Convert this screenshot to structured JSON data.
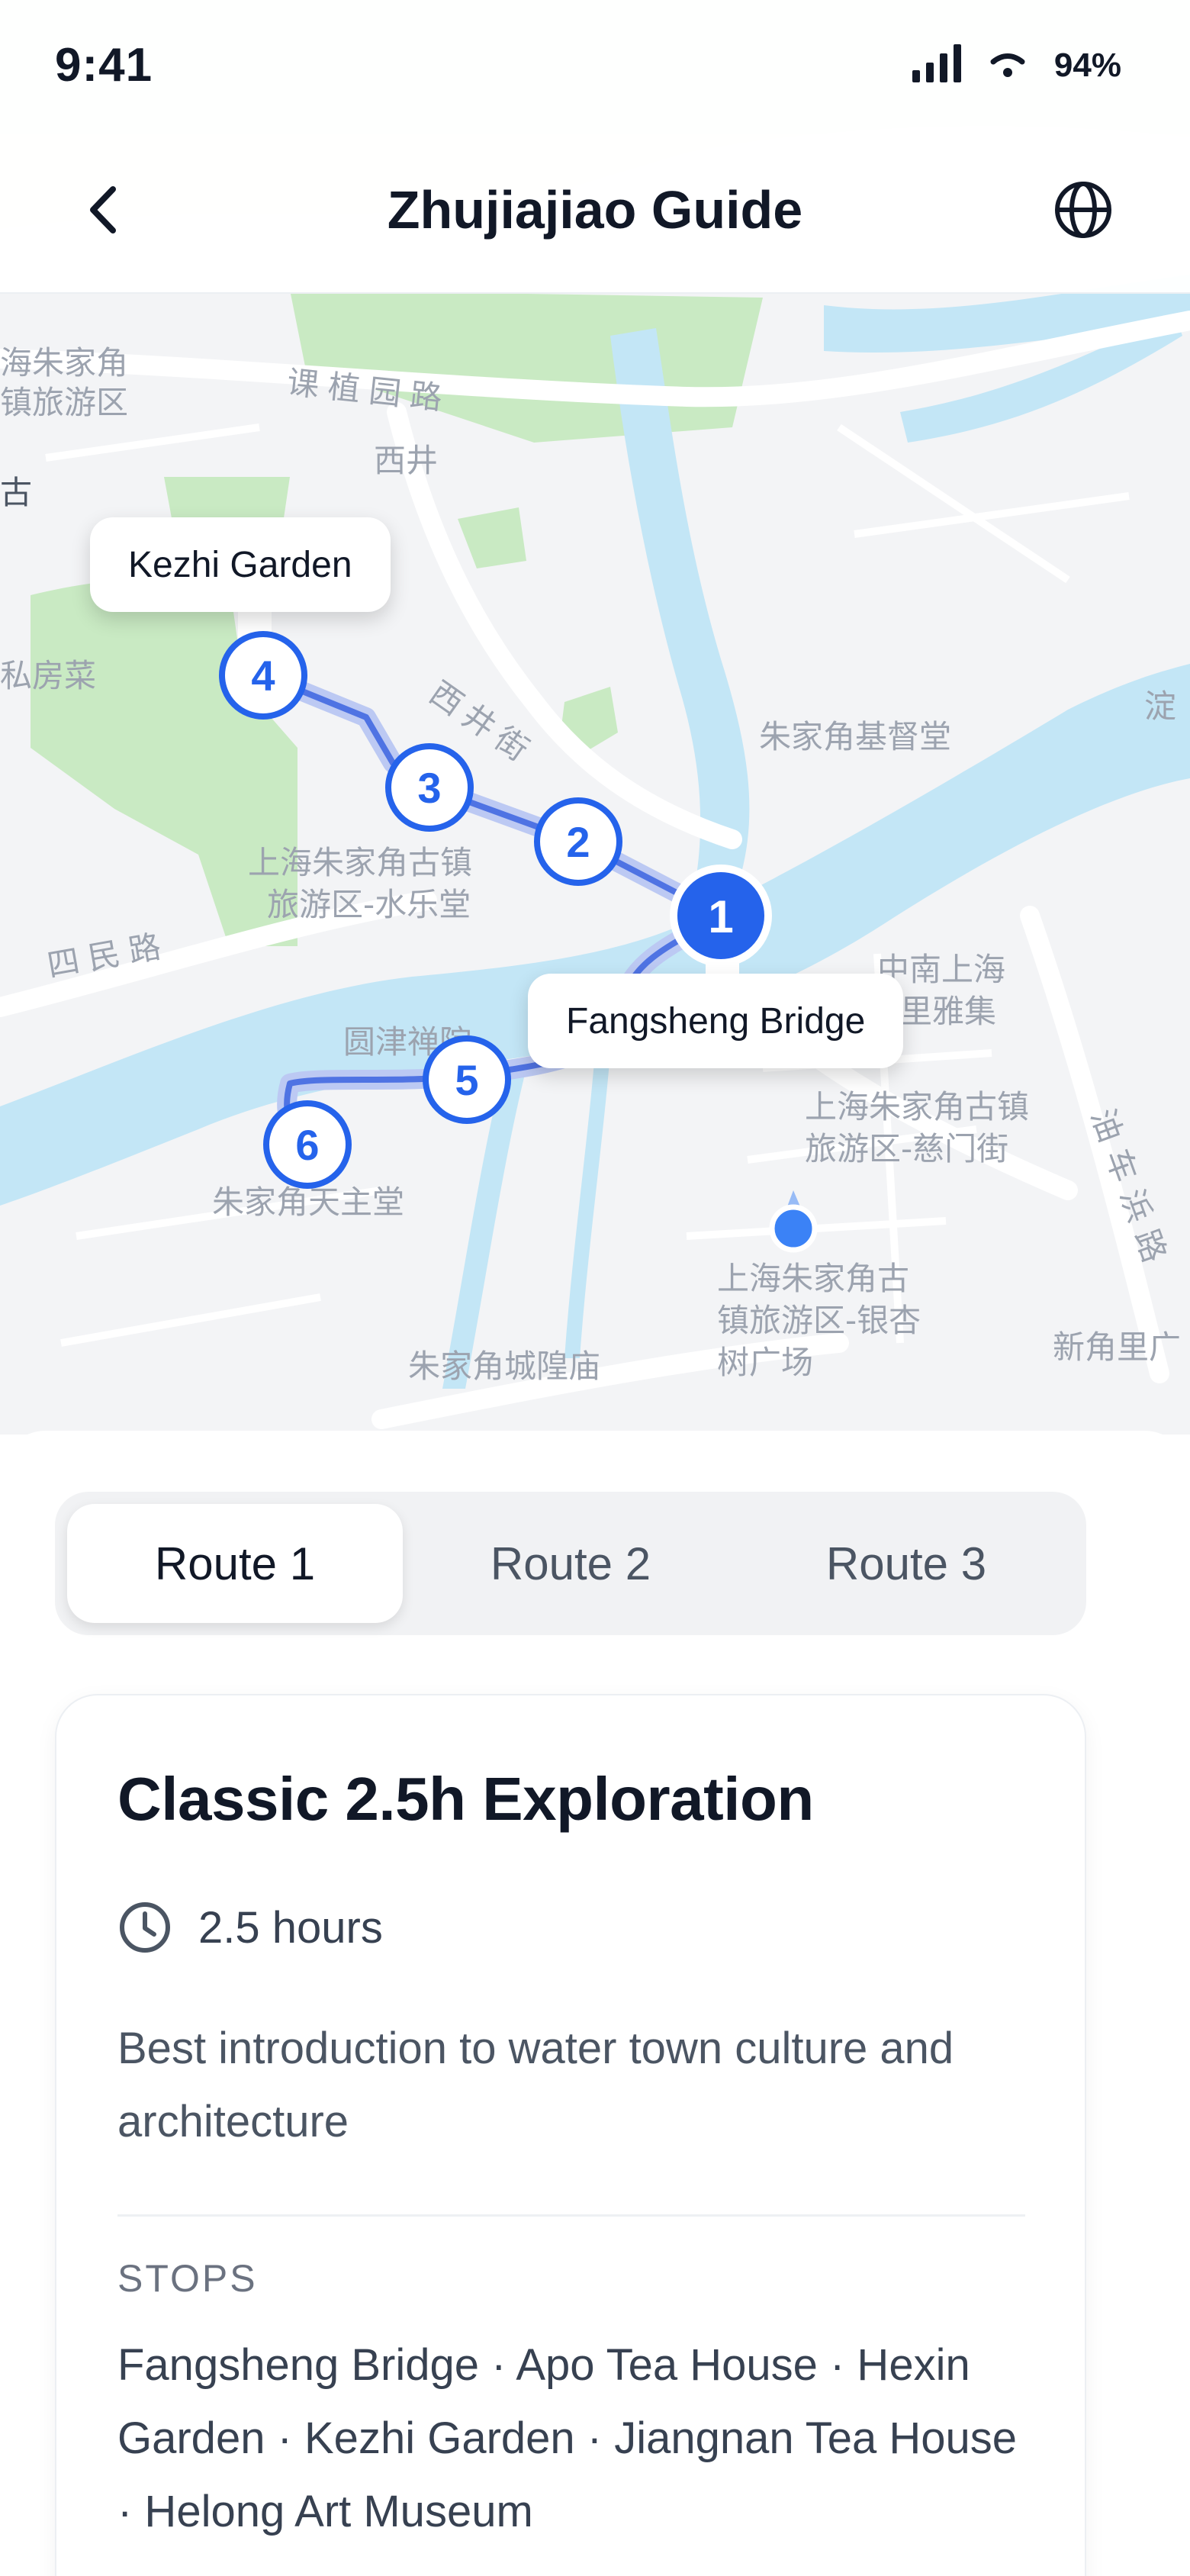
{
  "status_bar": {
    "time": "9:41",
    "battery": "94%"
  },
  "header": {
    "title": "Zhujiajiao Guide",
    "back_icon": "chevron-left-icon",
    "globe_icon": "globe-icon"
  },
  "map": {
    "callouts": {
      "kezhi": "Kezhi Garden",
      "fangsheng": "Fangsheng Bridge"
    },
    "markers": [
      "1",
      "2",
      "3",
      "4",
      "5",
      "6"
    ],
    "labels": [
      "海朱家角",
      "镇旅游区",
      "古",
      "私房菜",
      "课植园路",
      "西井",
      "西井街",
      "朱家角基督堂",
      "淀",
      "上海朱家角古镇",
      "旅游区-水乐堂",
      "四民路",
      "圆津禅院",
      "中南上海",
      "里雅集",
      "上海朱家角古镇",
      "旅游区-慈门街",
      "油车浜路",
      "朱家角天主堂",
      "上海朱家角古",
      "镇旅游区-银杏",
      "树广场",
      "新角里广",
      "朱家角城隍庙"
    ],
    "colors": {
      "water": "#c3e6f6",
      "park": "#c9eac3",
      "route": "#4f73e3",
      "marker": "#2563eb",
      "road": "#ffffff"
    }
  },
  "tabs": [
    {
      "label": "Route 1",
      "active": true
    },
    {
      "label": "Route 2",
      "active": false
    },
    {
      "label": "Route 3",
      "active": false
    }
  ],
  "route": {
    "title": "Classic 2.5h Exploration",
    "duration": "2.5 hours",
    "duration_icon": "clock-icon",
    "description": "Best introduction to water town culture and architecture",
    "stops_label": "STOPS",
    "stops": "Fangsheng Bridge · Apo Tea House · Hexin Garden · Kezhi Garden · Jiangnan Tea House · Helong Art Museum"
  }
}
